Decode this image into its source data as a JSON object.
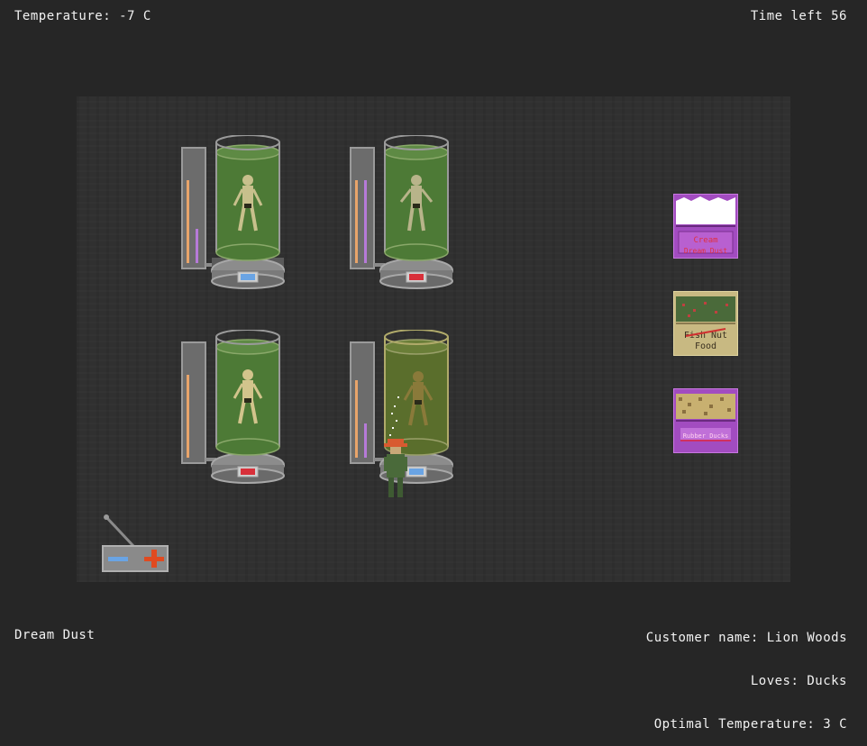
{
  "hud": {
    "temperature": "Temperature: -7 C",
    "time_left": "Time left 56",
    "bottom_left": "Dream Dust",
    "customer_name": "Customer name: Lion Woods",
    "loves": "Loves: Ducks",
    "optimal_temperature": "Optimal Temperature: 3 C"
  },
  "pods": [
    {
      "id": "top-left",
      "status_light": "blue",
      "bar1_level": 0.75,
      "bar2_level": 0.35,
      "fluid_color": "#4d7a36"
    },
    {
      "id": "top-right",
      "status_light": "red",
      "bar1_level": 0.75,
      "bar2_level": 0.75,
      "fluid_color": "#4d7a36"
    },
    {
      "id": "bottom-left",
      "status_light": "red",
      "bar1_level": 0.75,
      "bar2_level": 0.0,
      "fluid_color": "#4d7a36"
    },
    {
      "id": "bottom-right",
      "status_light": "blue",
      "bar1_level": 0.75,
      "bar2_level": 0.35,
      "fluid_color": "#5a6e2c"
    }
  ],
  "crates": [
    {
      "id": "dream-dust",
      "label_top": "Cream",
      "label_bottom": "Dream Dust",
      "fill": "white",
      "color": "#a24cc0"
    },
    {
      "id": "food",
      "label_top": "Fish Nut",
      "label_bottom": "Food",
      "fill": "green",
      "color": "#c8b982"
    },
    {
      "id": "rubber-ducks",
      "label_top": "",
      "label_bottom": "Rubber Ducks",
      "fill": "tan",
      "color": "#a24cc0"
    }
  ],
  "colors": {
    "background": "#262626",
    "floor": "#303030",
    "text": "#f2f2f2",
    "bar_orange": "#e8a46a",
    "bar_purple": "#b67ad8",
    "light_blue": "#6aa4e4",
    "light_red": "#d8303a"
  }
}
